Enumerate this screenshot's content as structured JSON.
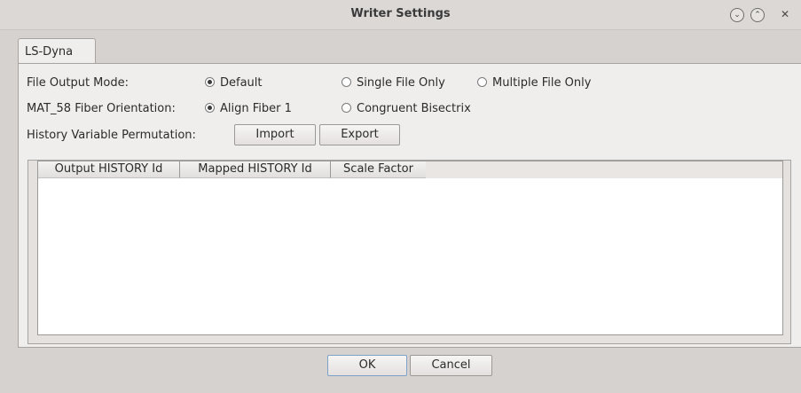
{
  "window": {
    "title": "Writer Settings",
    "controls": [
      "⌄",
      "⌃",
      "✕"
    ]
  },
  "tabs": [
    {
      "label": "LS-Dyna"
    }
  ],
  "file_output_mode": {
    "label": "File Output Mode:",
    "options": [
      {
        "label": "Default",
        "selected": true
      },
      {
        "label": "Single File Only",
        "selected": false
      },
      {
        "label": "Multiple File Only",
        "selected": false
      }
    ]
  },
  "mat58": {
    "label": "MAT_58 Fiber Orientation:",
    "options": [
      {
        "label": "Align Fiber 1",
        "selected": true
      },
      {
        "label": "Congruent Bisectrix",
        "selected": false
      }
    ]
  },
  "history": {
    "label": "History Variable Permutation:",
    "import_label": "Import",
    "export_label": "Export"
  },
  "table": {
    "columns": [
      "Output HISTORY Id",
      "Mapped HISTORY Id",
      "Scale Factor"
    ],
    "rows": []
  },
  "footer": {
    "ok_label": "OK",
    "cancel_label": "Cancel"
  }
}
